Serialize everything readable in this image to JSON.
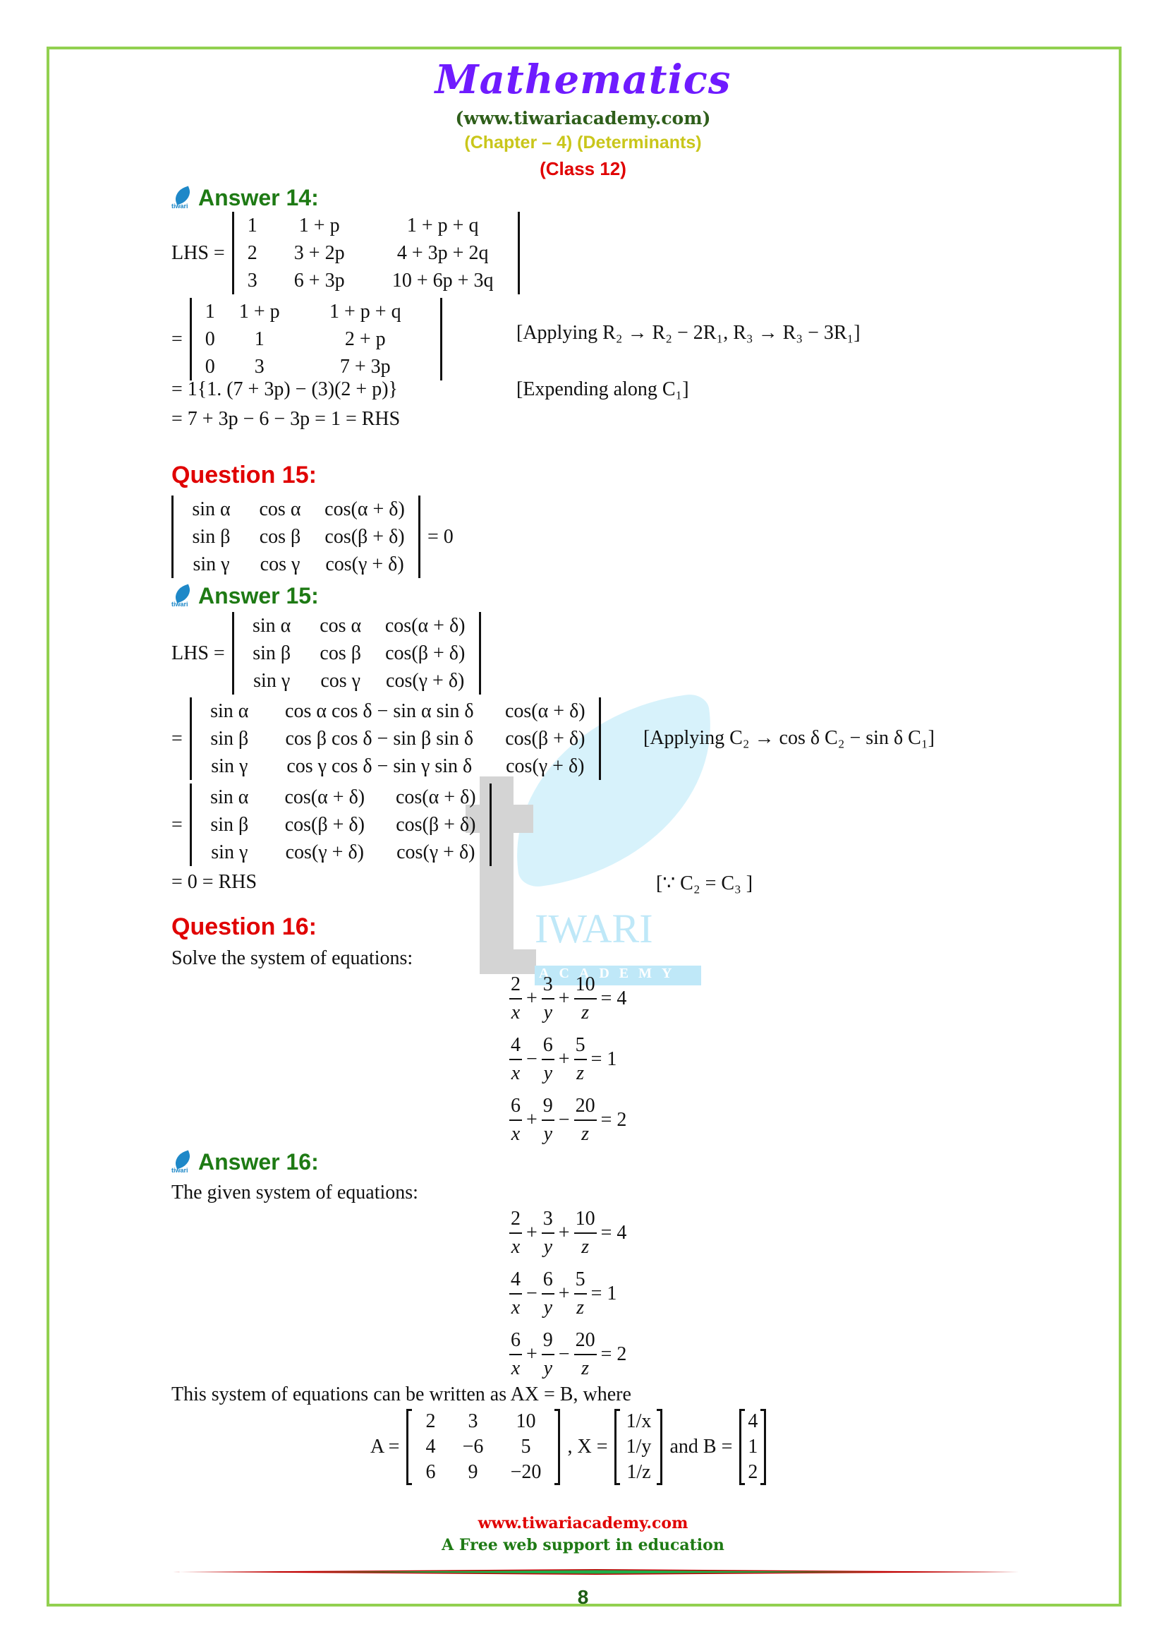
{
  "header": {
    "title": "Mathematics",
    "website": "(www.tiwariacademy.com)",
    "chapter": "(Chapter – 4) (Determinants)",
    "class": "(Class 12)"
  },
  "watermark": {
    "letter": "t",
    "word": "IWARI",
    "sub": "ACADEMY"
  },
  "icon_label": "tiwari",
  "answer14": {
    "heading": "Answer 14:",
    "lhs_label": "LHS =",
    "det1": [
      [
        "1",
        "1 + p",
        "1 + p + q"
      ],
      [
        "2",
        "3 + 2p",
        "4 + 3p + 2q"
      ],
      [
        "3",
        "6 + 3p",
        "10 + 6p + 3q"
      ]
    ],
    "eq": "=",
    "det2": [
      [
        "1",
        "1 + p",
        "1 + p + q"
      ],
      [
        "0",
        "1",
        "2 + p"
      ],
      [
        "0",
        "3",
        "7 + 3p"
      ]
    ],
    "note1": "[Applying R₂ → R₂ − 2R₁, R₃ → R₃ − 3R₁]",
    "step3": "= 1{1. (7 + 3p) − (3)(2 + p)}",
    "note2": "[Expending along C₁]",
    "step4": "= 7 + 3p − 6 − 3p = 1 = RHS"
  },
  "question15": {
    "heading": "Question 15:",
    "det": [
      [
        "sin α",
        "cos α",
        "cos(α + δ)"
      ],
      [
        "sin β",
        "cos β",
        "cos(β + δ)"
      ],
      [
        "sin γ",
        "cos γ",
        "cos(γ + δ)"
      ]
    ],
    "rhs": "= 0"
  },
  "answer15": {
    "heading": "Answer 15:",
    "lhs_label": "LHS =",
    "det1": [
      [
        "sin α",
        "cos α",
        "cos(α + δ)"
      ],
      [
        "sin β",
        "cos β",
        "cos(β + δ)"
      ],
      [
        "sin γ",
        "cos γ",
        "cos(γ + δ)"
      ]
    ],
    "eq": "=",
    "det2": [
      [
        "sin α",
        "cos α cos δ − sin α sin δ",
        "cos(α + δ)"
      ],
      [
        "sin β",
        "cos β cos δ − sin β sin δ",
        "cos(β + δ)"
      ],
      [
        "sin γ",
        "cos γ cos δ − sin γ sin δ",
        "cos(γ + δ)"
      ]
    ],
    "note1": "[Applying C₂ → cos δ C₂ − sin δ C₁]",
    "det3": [
      [
        "sin α",
        "cos(α + δ)",
        "cos(α + δ)"
      ],
      [
        "sin β",
        "cos(β + δ)",
        "cos(β + δ)"
      ],
      [
        "sin γ",
        "cos(γ + δ)",
        "cos(γ + δ)"
      ]
    ],
    "final": "= 0 = RHS",
    "note2": "[∵ C₂ = C₃ ]"
  },
  "question16": {
    "heading": "Question 16:",
    "intro": "Solve the system of equations:",
    "equations": [
      {
        "terms": [
          {
            "sign": "",
            "num": "2",
            "den": "x"
          },
          {
            "sign": "+",
            "num": "3",
            "den": "y"
          },
          {
            "sign": "+",
            "num": "10",
            "den": "z"
          }
        ],
        "rhs": "= 4"
      },
      {
        "terms": [
          {
            "sign": "",
            "num": "4",
            "den": "x"
          },
          {
            "sign": "−",
            "num": "6",
            "den": "y"
          },
          {
            "sign": "+",
            "num": "5",
            "den": "z"
          }
        ],
        "rhs": "= 1"
      },
      {
        "terms": [
          {
            "sign": "",
            "num": "6",
            "den": "x"
          },
          {
            "sign": "+",
            "num": "9",
            "den": "y"
          },
          {
            "sign": "−",
            "num": "20",
            "den": "z"
          }
        ],
        "rhs": "= 2"
      }
    ]
  },
  "answer16": {
    "heading": "Answer 16:",
    "intro": "The given system of equations:",
    "equations": [
      {
        "terms": [
          {
            "sign": "",
            "num": "2",
            "den": "x"
          },
          {
            "sign": "+",
            "num": "3",
            "den": "y"
          },
          {
            "sign": "+",
            "num": "10",
            "den": "z"
          }
        ],
        "rhs": "= 4"
      },
      {
        "terms": [
          {
            "sign": "",
            "num": "4",
            "den": "x"
          },
          {
            "sign": "−",
            "num": "6",
            "den": "y"
          },
          {
            "sign": "+",
            "num": "5",
            "den": "z"
          }
        ],
        "rhs": "= 1"
      },
      {
        "terms": [
          {
            "sign": "",
            "num": "6",
            "den": "x"
          },
          {
            "sign": "+",
            "num": "9",
            "den": "y"
          },
          {
            "sign": "−",
            "num": "20",
            "den": "z"
          }
        ],
        "rhs": "= 2"
      }
    ],
    "matrix_intro": "This system of equations can be written as AX = B, where",
    "A_label": "A =",
    "A": [
      [
        "2",
        "3",
        "10"
      ],
      [
        "4",
        "−6",
        "5"
      ],
      [
        "6",
        "9",
        "−20"
      ]
    ],
    "X_label": ", X =",
    "X": [
      [
        "1/x"
      ],
      [
        "1/y"
      ],
      [
        "1/z"
      ]
    ],
    "and_B_label": "and B =",
    "B": [
      [
        "4"
      ],
      [
        "1"
      ],
      [
        "2"
      ]
    ]
  },
  "footer": {
    "website": "www.tiwariacademy.com",
    "tagline": "A Free web support in education",
    "page_number": "8"
  },
  "colors": {
    "border": "#92D050",
    "title": "#6F1BFF",
    "answer": "#1E7A14",
    "question": "#E00000",
    "chapter": "#C9C61A"
  }
}
